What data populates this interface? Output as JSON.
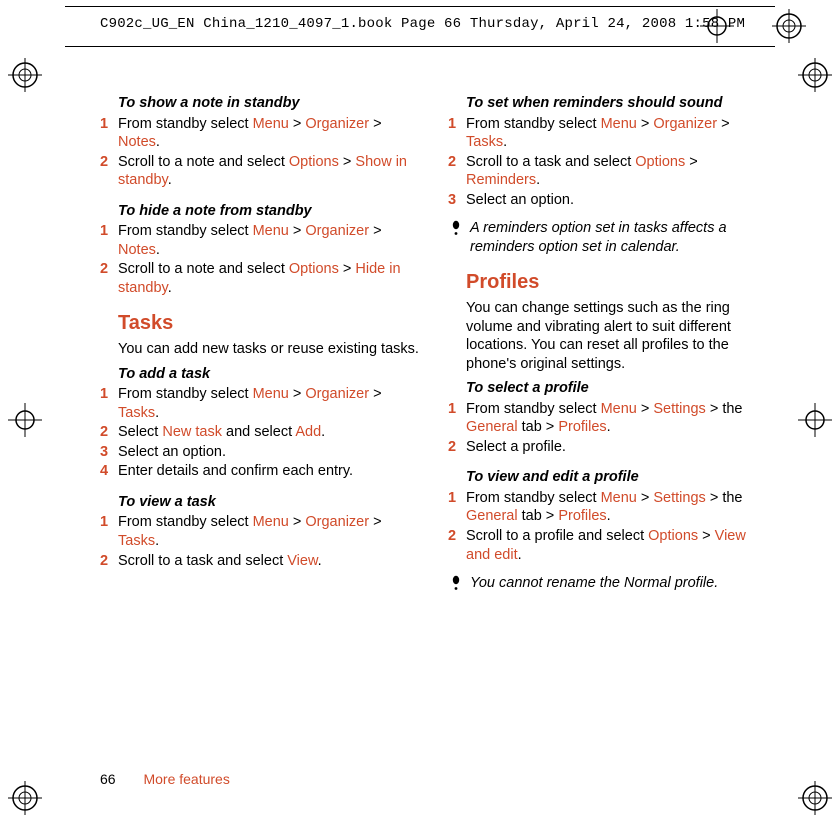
{
  "header": {
    "text": "C902c_UG_EN China_1210_4097_1.book  Page 66  Thursday, April 24, 2008  1:58 PM"
  },
  "footer": {
    "page": "66",
    "section": "More features"
  },
  "left": {
    "s1": {
      "title": "To show a note in standby",
      "steps": [
        {
          "n": "1",
          "pre": "From standby select ",
          "a": "Menu",
          "gt1": " > ",
          "b": "Organizer",
          "gt2": " > ",
          "c": "Notes",
          "post": "."
        },
        {
          "n": "2",
          "pre": "Scroll to a note and select ",
          "a": "Options",
          "gt1": " > ",
          "b": "Show in standby",
          "post": "."
        }
      ]
    },
    "s2": {
      "title": "To hide a note from standby",
      "steps": [
        {
          "n": "1",
          "pre": "From standby select ",
          "a": "Menu",
          "gt1": " > ",
          "b": "Organizer",
          "gt2": " > ",
          "c": "Notes",
          "post": "."
        },
        {
          "n": "2",
          "pre": "Scroll to a note and select ",
          "a": "Options",
          "gt1": " > ",
          "b": "Hide in standby",
          "post": "."
        }
      ]
    },
    "tasks": {
      "heading": "Tasks",
      "intro": "You can add new tasks or reuse existing tasks."
    },
    "s3": {
      "title": "To add a task",
      "step1": {
        "n": "1",
        "pre": "From standby select ",
        "a": "Menu",
        "gt1": " > ",
        "b": "Organizer",
        "gt2": " > ",
        "c": "Tasks",
        "post": "."
      },
      "step2": {
        "n": "2",
        "pre": "Select ",
        "a": "New task",
        "mid": " and select ",
        "b": "Add",
        "post": "."
      },
      "step3": {
        "n": "3",
        "txt": "Select an option."
      },
      "step4": {
        "n": "4",
        "txt": "Enter details and confirm each entry."
      }
    },
    "s4": {
      "title": "To view a task",
      "step1": {
        "n": "1",
        "pre": "From standby select ",
        "a": "Menu",
        "gt1": " > ",
        "b": "Organizer",
        "gt2": " > ",
        "c": "Tasks",
        "post": "."
      },
      "step2": {
        "n": "2",
        "pre": "Scroll to a task and select ",
        "a": "View",
        "post": "."
      }
    }
  },
  "right": {
    "s1": {
      "title": "To set when reminders should sound",
      "step1": {
        "n": "1",
        "pre": "From standby select ",
        "a": "Menu",
        "gt1": " > ",
        "b": "Organizer",
        "gt2": " > ",
        "c": "Tasks",
        "post": "."
      },
      "step2": {
        "n": "2",
        "pre": "Scroll to a task and select ",
        "a": "Options",
        "gt1": " > ",
        "b": "Reminders",
        "post": "."
      },
      "step3": {
        "n": "3",
        "txt": "Select an option."
      }
    },
    "note1": "A reminders option set in tasks affects a reminders option set in calendar.",
    "profiles": {
      "heading": "Profiles",
      "intro": "You can change settings such as the ring volume and vibrating alert to suit different locations. You can reset all profiles to the phone's original settings."
    },
    "s2": {
      "title": "To select a profile",
      "step1": {
        "n": "1",
        "pre": "From standby select ",
        "a": "Menu",
        "gt1": " > ",
        "b": "Settings",
        "gt2": " > the ",
        "c": "General",
        "mid": " tab > ",
        "d": "Profiles",
        "post": "."
      },
      "step2": {
        "n": "2",
        "txt": "Select a profile."
      }
    },
    "s3": {
      "title": "To view and edit a profile",
      "step1": {
        "n": "1",
        "pre": "From standby select ",
        "a": "Menu",
        "gt1": " > ",
        "b": "Settings",
        "gt2": " > the ",
        "c": "General",
        "mid": " tab > ",
        "d": "Profiles",
        "post": "."
      },
      "step2": {
        "n": "2",
        "pre": "Scroll to a profile and select ",
        "a": "Options",
        "gt1": " > ",
        "b": "View and edit",
        "post": "."
      }
    },
    "note2": "You cannot rename the Normal profile."
  }
}
